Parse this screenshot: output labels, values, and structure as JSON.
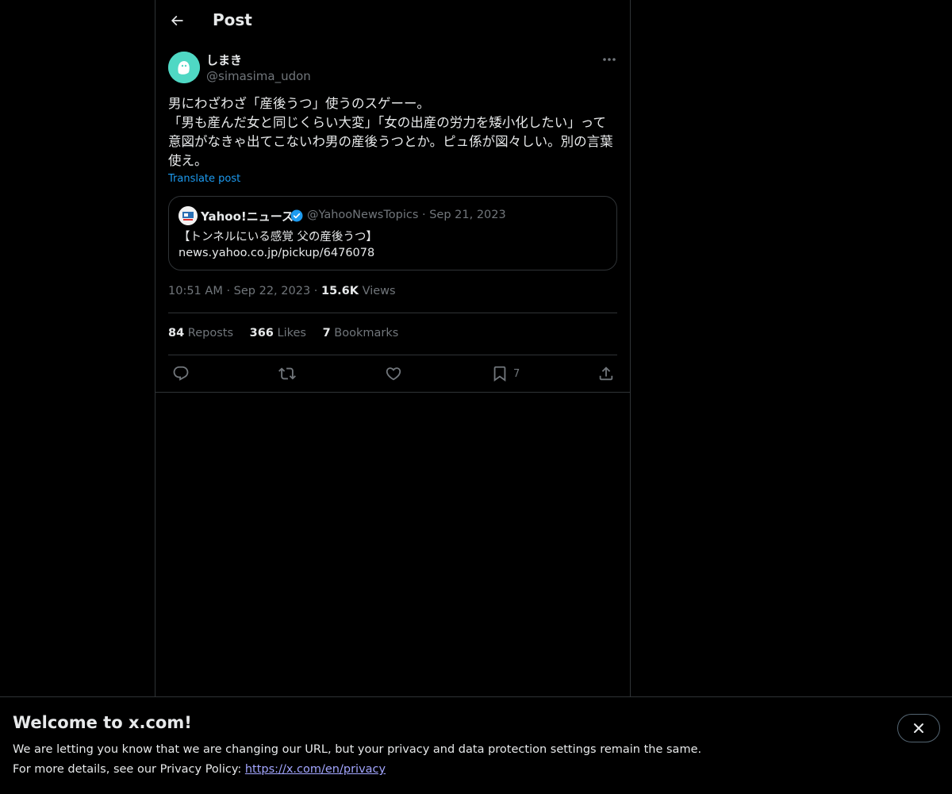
{
  "header": {
    "title": "Post"
  },
  "post": {
    "author_name": "しまき",
    "author_handle": "@simasima_udon",
    "text": "男にわざわざ「産後うつ」使うのスゲーー。\n「男も産んだ女と同じくらい大変」「女の出産の労力を矮小化したい」って意図がなきゃ出てこないわ男の産後うつとか。ピュ係が図々しい。別の言葉使え。",
    "translate_label": "Translate post",
    "quote": {
      "name": "Yahoo!ニュース",
      "handle_date": "@YahooNewsTopics · Sep 21, 2023",
      "text_line1": "【トンネルにいる感覚 父の産後うつ】",
      "text_line2": "news.yahoo.co.jp/pickup/6476078"
    },
    "time": "10:51 AM",
    "date": "Sep 22, 2023",
    "views_count": "15.6K",
    "views_label": "Views",
    "reposts_count": "84",
    "reposts_label": "Reposts",
    "likes_count": "366",
    "likes_label": "Likes",
    "bookmarks_count": "7",
    "bookmarks_label": "Bookmarks",
    "bookmark_action_count": "7"
  },
  "banner": {
    "title": "Welcome to x.com!",
    "line1": "We are letting you know that we are changing our URL, but your privacy and data protection settings remain the same.",
    "line2_prefix": "For more details, see our Privacy Policy: ",
    "link": "https://x.com/en/privacy"
  },
  "icons": {
    "back": "arrow-left-icon",
    "more": "more-horizontal-icon",
    "verified": "verified-badge-icon",
    "reply": "reply-icon",
    "repost": "repost-icon",
    "like": "heart-icon",
    "bookmark": "bookmark-icon",
    "share": "share-icon",
    "close": "close-icon"
  },
  "colors": {
    "background": "#000000",
    "text": "#e7e9ea",
    "muted": "#71767b",
    "accent": "#1d9bf0",
    "border": "#2f3336"
  }
}
